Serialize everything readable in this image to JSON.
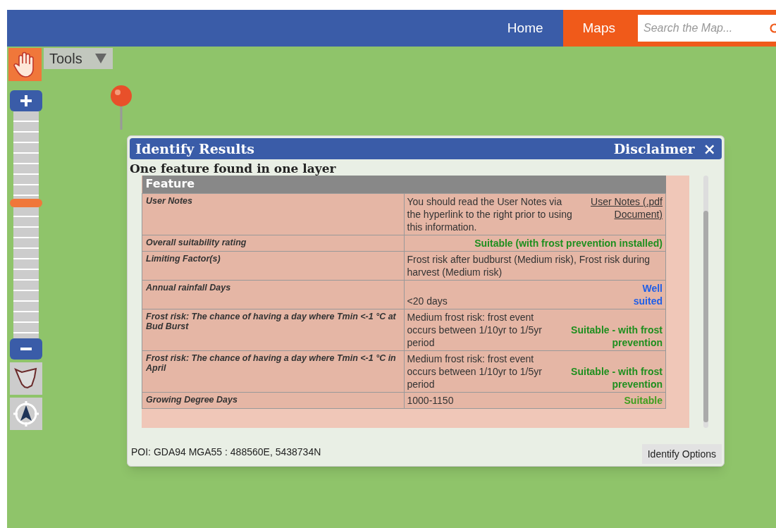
{
  "nav": [
    {
      "label": "Home",
      "selected": false
    },
    {
      "label": "Maps",
      "selected": true
    }
  ],
  "search": {
    "placeholder": "Search the Map..."
  },
  "tools": {
    "label": "Tools"
  },
  "zoom": {
    "level": 0.6
  },
  "dialog": {
    "title": "Identify Results",
    "disclaimer": "Disclaimer",
    "close": "×",
    "summary": "One feature found in one layer",
    "table_heading": "Feature",
    "rows": [
      {
        "label": "User Notes",
        "value": "You should read the User Notes via the hyperlink to the right prior to using this information.",
        "link": "User Notes (.pdf Document)"
      },
      {
        "label": "Overall suitability rating",
        "rating": "Suitable (with frost prevention installed)",
        "color": "#1f8f1f"
      },
      {
        "label": "Limiting Factor(s)",
        "value": "Frost risk after budburst (Medium risk), Frost risk during harvest (Medium risk)"
      },
      {
        "label": "Annual rainfall Days",
        "value": "<20 days",
        "rating": "Well suited",
        "color": "#1e5ee8"
      },
      {
        "label": "Frost risk: The chance of having a day where Tmin <-1 °C at Bud Burst",
        "value": "Medium frost risk: frost event occurs between 1/10yr to 1/5yr period",
        "rating": "Suitable - with frost prevention",
        "color": "#1f8f1f"
      },
      {
        "label": "Frost risk: The chance of having a day where Tmin <-1 °C in April",
        "value": "Medium frost risk: frost event occurs between 1/10yr to 1/5yr period",
        "rating": "Suitable - with frost prevention",
        "color": "#1f8f1f"
      },
      {
        "label": "Growing Degree Days",
        "value": "1000-1150",
        "rating": "Suitable",
        "color": "#3f9f1f"
      }
    ],
    "poi": "POI: GDA94 MGA55 : 488560E, 5438734N",
    "options_button": "Identify Options"
  }
}
